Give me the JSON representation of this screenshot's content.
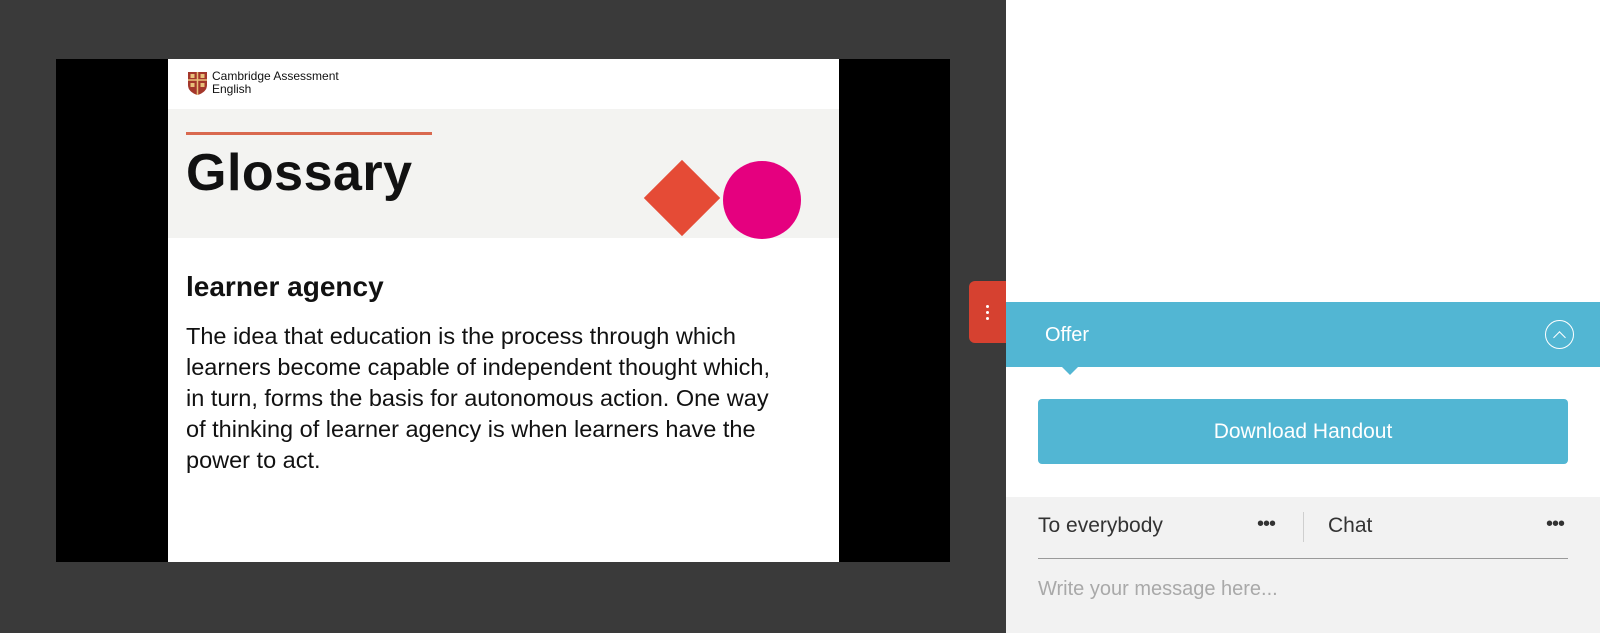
{
  "slide": {
    "logo_line1": "Cambridge Assessment",
    "logo_line2": "English",
    "title": "Glossary",
    "term": "learner agency",
    "definition": "The idea that education is the process through which learners become capable of independent thought which, in turn, forms the basis for autonomous action. One way of thinking of learner agency is when learners have the power to act.",
    "colors": {
      "diamond": "#e54b36",
      "circle": "#e5007f",
      "rule": "#d9694f"
    }
  },
  "panel": {
    "offer_label": "Offer",
    "download_label": "Download Handout",
    "accent": "#52b6d3"
  },
  "chat": {
    "recipient": "To everybody",
    "recipient_more": "•••",
    "tab_label": "Chat",
    "tab_more": "•••",
    "input_placeholder": "Write your message here..."
  }
}
